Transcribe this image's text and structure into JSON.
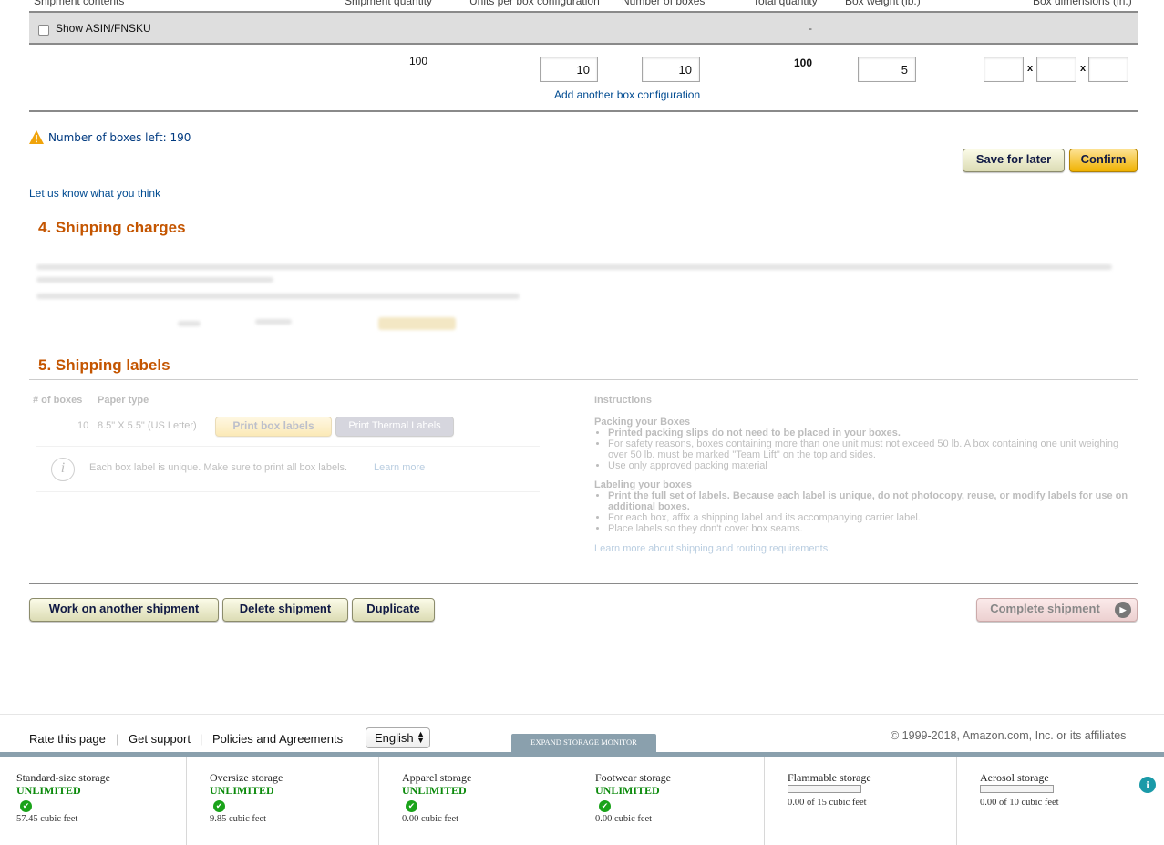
{
  "table": {
    "headers": [
      "Shipment contents",
      "Shipment quantity",
      "Units per box configuration",
      "Number of boxes",
      "Total quantity",
      "Box weight (lb.)",
      "Box dimensions (in.)"
    ],
    "show_asin_label": "Show ASIN/FNSKU",
    "gray_row_dash": "-",
    "row": {
      "shipment_quantity": "100",
      "units_per_box": "10",
      "number_of_boxes": "10",
      "total_quantity": "100",
      "box_weight": "5",
      "dim_sep": "x"
    },
    "add_config_link": "Add another box configuration"
  },
  "boxes_left": "Number of boxes left: 190",
  "buttons": {
    "save_later": "Save for later",
    "confirm": "Confirm"
  },
  "feedback_link": "Let us know what you think",
  "section4": {
    "title": "4. Shipping charges"
  },
  "section5": {
    "title": "5. Shipping labels",
    "col_boxes": "# of boxes",
    "col_paper": "Paper type",
    "boxes_value": "10",
    "paper_value": "8.5\" X 5.5\" (US Letter)",
    "print_box_labels": "Print box labels",
    "print_thermal": "Print Thermal Labels",
    "info_text": "Each box label is unique. Make sure to print all box labels.",
    "learn_more": "Learn more",
    "instructions_title": "Instructions",
    "packing_title": "Packing your Boxes",
    "packing_items": [
      "Printed packing slips do not need to be placed in your boxes.",
      "For safety reasons, boxes containing more than one unit must not exceed 50 lb. A box containing one unit weighing over 50 lb. must be marked \"Team Lift\" on the top and sides.",
      "Use only approved packing material"
    ],
    "labeling_title": "Labeling your boxes",
    "labeling_items": [
      "Print the full set of labels. Because each label is unique, do not photocopy, reuse, or modify labels for use on additional boxes.",
      "For each box, affix a shipping label and its accompanying carrier label.",
      "Place labels so they don't cover box seams."
    ],
    "learn_more_routing": "Learn more about shipping and routing requirements."
  },
  "bottom_buttons": {
    "work_another": "Work on another shipment",
    "delete": "Delete shipment",
    "duplicate": "Duplicate",
    "complete": "Complete shipment"
  },
  "footer": {
    "rate": "Rate this page",
    "support": "Get support",
    "policies": "Policies and Agreements",
    "language": "English",
    "copyright": "© 1999-2018, Amazon.com, Inc. or its affiliates",
    "expand_storage": "EXPAND STORAGE MONITOR"
  },
  "storage": [
    {
      "title": "Standard-size storage",
      "status": "UNLIMITED",
      "value": "57.45 cubic feet"
    },
    {
      "title": "Oversize storage",
      "status": "UNLIMITED",
      "value": "9.85 cubic feet"
    },
    {
      "title": "Apparel storage",
      "status": "UNLIMITED",
      "value": "0.00 cubic feet"
    },
    {
      "title": "Footwear storage",
      "status": "UNLIMITED",
      "value": "0.00 cubic feet"
    },
    {
      "title": "Flammable storage",
      "value": "0.00 of 15 cubic feet"
    },
    {
      "title": "Aerosol storage",
      "value": "0.00 of 10 cubic feet"
    }
  ],
  "colors": {
    "accent": "#c45500",
    "link": "#004b91",
    "unlimited": "#0b8a0b"
  }
}
